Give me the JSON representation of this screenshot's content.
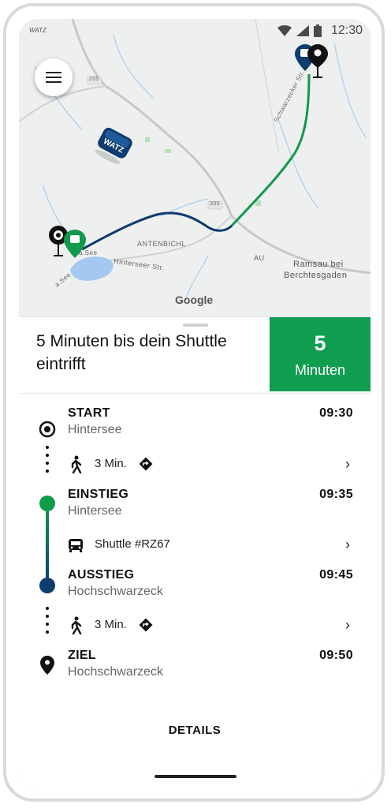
{
  "status_bar": {
    "time": "12:30"
  },
  "map": {
    "brand_small": "WATZ",
    "menu_icon": "hamburger-menu-icon",
    "labels": {
      "road_205_a": "205",
      "road_205_b": "305",
      "antenbichl": "ANTENBICHL",
      "au": "AU",
      "ramsau_line1": "Ramsau bei",
      "ramsau_line2": "Berchtesgaden",
      "hinterseer": "Hinterseer Str.",
      "see_a": "a.See",
      "see_b": "a.See",
      "road_vertical": "Schwarzecker Str."
    },
    "google_text": "Google",
    "colors": {
      "route_blue": "#0d3c6e",
      "route_green": "#119a4a"
    }
  },
  "banner": {
    "message": "5 Minuten bis dein Shuttle eintrifft",
    "eta_value": "5",
    "eta_unit": "Minuten"
  },
  "itinerary": {
    "stops": [
      {
        "title": "START",
        "place": "Hintersee",
        "time": "09:30",
        "icon": "start-target-icon"
      },
      {
        "title": "EINSTIEG",
        "place": "Hintersee",
        "time": "09:35",
        "icon": "boarding-dot-icon"
      },
      {
        "title": "AUSSTIEG",
        "place": "Hochschwarzeck",
        "time": "09:45",
        "icon": "alighting-dot-icon"
      },
      {
        "title": "ZIEL",
        "place": "Hochschwarzeck",
        "time": "09:50",
        "icon": "destination-pin-icon"
      }
    ],
    "legs": [
      {
        "label": "3 Min.",
        "icon": "walking-icon",
        "extra_icon": "directions-icon"
      },
      {
        "label": "Shuttle #RZ67",
        "icon": "shuttle-bus-icon"
      },
      {
        "label": "3 Min.",
        "icon": "walking-icon",
        "extra_icon": "directions-icon"
      }
    ],
    "details_label": "DETAILS"
  }
}
